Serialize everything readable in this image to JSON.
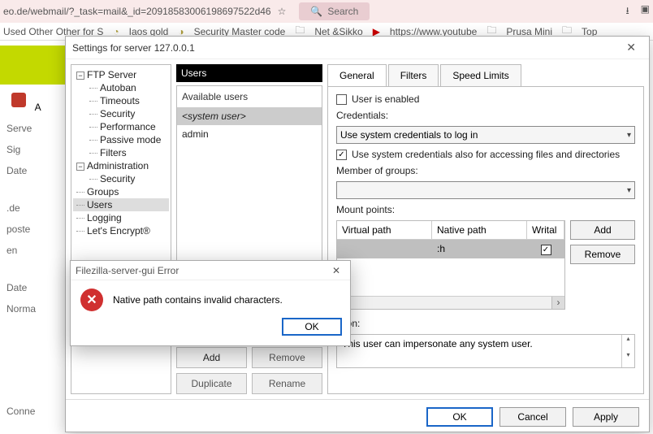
{
  "browser": {
    "url_fragment": "eo.de/webmail/?_task=mail&_id=20918583006198697522d46",
    "search_placeholder": "Search",
    "bookmarks": [
      "Used Other Other for S",
      "Iaos gold",
      "Security Master code",
      "Net &Sikko",
      "https://www.youtube",
      "Prusa Mini",
      "Top"
    ]
  },
  "left_strip": {
    "server_btn": "Serve",
    "sign": "Sig",
    "date1": "Date",
    "de": ".de",
    "poste": "poste",
    "en": "en",
    "date2": "Date",
    "norma": "Norma",
    "conne": "Conne"
  },
  "dialog": {
    "title": "Settings for server 127.0.0.1",
    "tree": {
      "ftp_server": "FTP Server",
      "autoban": "Autoban",
      "timeouts": "Timeouts",
      "security": "Security",
      "performance": "Performance",
      "passive_mode": "Passive mode",
      "filters": "Filters",
      "administration": "Administration",
      "admin_security": "Security",
      "groups": "Groups",
      "users": "Users",
      "logging": "Logging",
      "lets_encrypt": "Let's Encrypt®"
    },
    "users_header": "Users",
    "available_users": "Available users",
    "user_list": {
      "system_user": "<system user>",
      "admin": "admin"
    },
    "user_btns": {
      "add": "Add",
      "remove": "Remove",
      "duplicate": "Duplicate",
      "rename": "Rename"
    },
    "tabs": {
      "general": "General",
      "filters": "Filters",
      "speed_limits": "Speed Limits"
    },
    "general": {
      "user_enabled": "User is enabled",
      "credentials_label": "Credentials:",
      "credentials_value": "Use system credentials to log in",
      "use_sys_creds_files": "Use system credentials also for accessing files and directories",
      "member_of_groups": "Member of groups:",
      "mount_points": "Mount points:",
      "mnt_headers": {
        "vpath": "Virtual path",
        "npath": "Native path",
        "writable": "Writal"
      },
      "mnt_row": {
        "vpath": "",
        "npath": ":h",
        "writable": true
      },
      "mnt_btns": {
        "add": "Add",
        "remove": "Remove"
      },
      "description_label": "ption:",
      "description_value": "This user can impersonate any system user."
    },
    "footer": {
      "ok": "OK",
      "cancel": "Cancel",
      "apply": "Apply"
    }
  },
  "error": {
    "title": "Filezilla-server-gui Error",
    "message": "Native path contains invalid characters.",
    "ok": "OK"
  }
}
